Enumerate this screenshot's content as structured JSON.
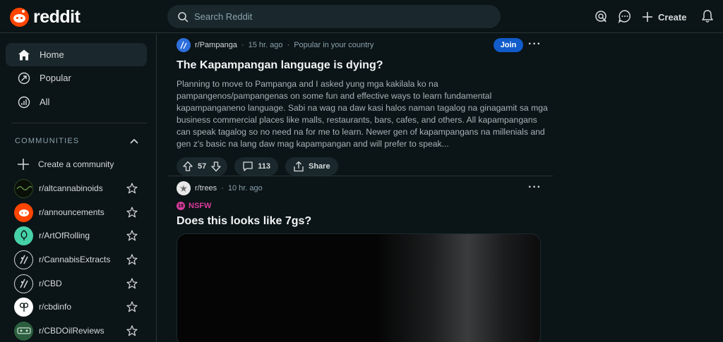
{
  "header": {
    "logo_text": "reddit",
    "search_placeholder": "Search Reddit",
    "create_label": "Create",
    "icons": [
      "advertise-icon",
      "chat-icon",
      "plus-icon",
      "notification-bell-icon"
    ]
  },
  "sidebar": {
    "nav": [
      {
        "label": "Home",
        "icon": "home-icon",
        "active": true
      },
      {
        "label": "Popular",
        "icon": "popular-arrow-icon",
        "active": false
      },
      {
        "label": "All",
        "icon": "all-chart-icon",
        "active": false
      }
    ],
    "communities_header": "COMMUNITIES",
    "create_community": "Create a community",
    "communities": [
      {
        "name": "r/altcannabinoids",
        "color": "#1d3b1a"
      },
      {
        "name": "r/announcements",
        "color": "#ff4500"
      },
      {
        "name": "r/ArtOfRolling",
        "color": "#46d1a7"
      },
      {
        "name": "r/CannabisExtracts",
        "color": "#0b1416"
      },
      {
        "name": "r/CBD",
        "color": "#0b1416"
      },
      {
        "name": "r/cbdinfo",
        "color": "#ffffff"
      },
      {
        "name": "r/CBDOilReviews",
        "color": "#2b5d3e"
      }
    ]
  },
  "posts": [
    {
      "subreddit": "r/Pampanga",
      "time": "15 hr. ago",
      "context": "Popular in your country",
      "join_label": "Join",
      "title": "The Kapampangan language is dying?",
      "body": "Planning to move to Pampanga and I asked yung mga kakilala ko na pampangenos/pampangenas on some fun and effective ways to learn fundamental kapampanganeno language. Sabi na wag na daw kasi halos naman tagalog na ginagamit sa mga business commercial places like malls, restaurants, bars, cafes, and others. All kapampangans can speak tagalog so no need na for me to learn. Newer gen of kapampangans na millenials and gen z's basic na lang daw mag kapampangan and will prefer to speak...",
      "votes": "57",
      "comments": "113",
      "share_label": "Share"
    },
    {
      "subreddit": "r/trees",
      "time": "10 hr. ago",
      "nsfw_label": "NSFW",
      "title": "Does this looks like 7gs?"
    }
  ],
  "colors": {
    "background": "#0b1416",
    "brand": "#ff4500",
    "join": "#115bca",
    "nsfw": "#d93a9b"
  }
}
